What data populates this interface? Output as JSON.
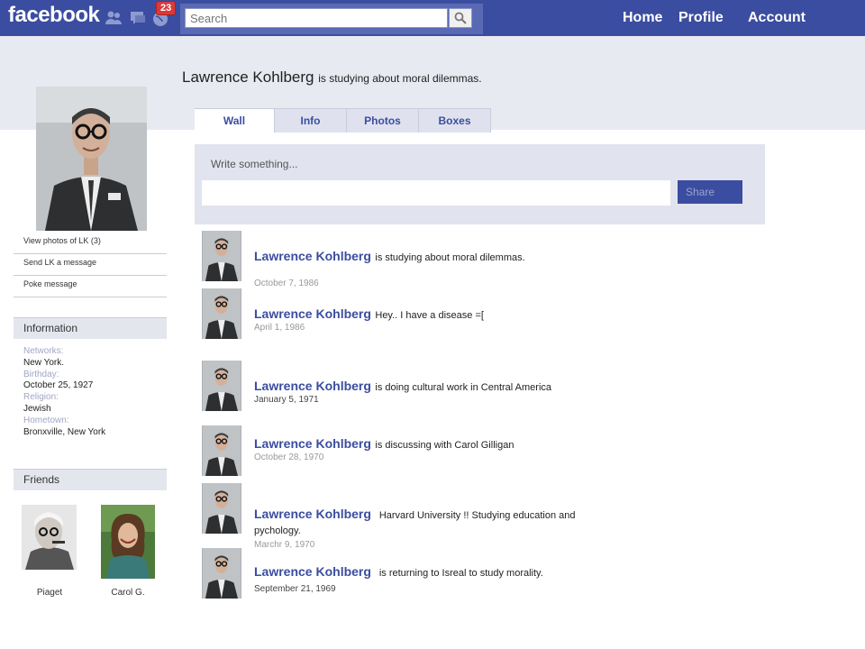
{
  "topbar": {
    "logo": "facebook",
    "notifications_count": "23",
    "search_placeholder": "Search",
    "nav": {
      "home": "Home",
      "profile": "Profile",
      "account": "Account"
    }
  },
  "profile": {
    "name": "Lawrence Kohlberg",
    "status": "is studying about moral dilemmas."
  },
  "tabs": [
    "Wall",
    "Info",
    "Photos",
    "Boxes"
  ],
  "composer": {
    "label": "Write something...",
    "share": "Share"
  },
  "side_links": [
    "View photos of LK (3)",
    "Send LK a message",
    "Poke message"
  ],
  "information": {
    "title": "Information",
    "fields": [
      {
        "label": "Networks:",
        "value": "New York."
      },
      {
        "label": "Birthday:",
        "value": "October 25, 1927"
      },
      {
        "label": "Religion:",
        "value": "Jewish"
      },
      {
        "label": "Hometown:",
        "value": "Bronxville, New York"
      }
    ]
  },
  "friends": {
    "title": "Friends",
    "items": [
      {
        "name": "Piaget"
      },
      {
        "name": "Carol G."
      }
    ]
  },
  "posts": [
    {
      "name": "Lawrence Kohlberg",
      "text": "is studying about moral dilemmas.",
      "date": "October 7, 1986"
    },
    {
      "name": "Lawrence Kohlberg",
      "text": "Hey.. I have a disease =[",
      "date": "April 1, 1986"
    },
    {
      "name": "Lawrence Kohlberg",
      "text": "is doing cultural work in Central America",
      "date": "January 5, 1971"
    },
    {
      "name": "Lawrence Kohlberg",
      "text": "is discussing with Carol Gilligan",
      "date": "October 28, 1970"
    },
    {
      "name": "Lawrence Kohlberg",
      "text": "Harvard University !! Studying education and pychology.",
      "date": "Marchr 9, 1970"
    },
    {
      "name": "Lawrence Kohlberg",
      "text": "is returning to Isreal to study morality.",
      "date": "September 21, 1969"
    }
  ],
  "colors": {
    "brand": "#3b4da0",
    "badge": "#d83a3a",
    "header_band": "#e8eaf1"
  }
}
